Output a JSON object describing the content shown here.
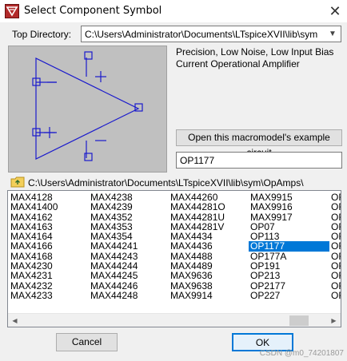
{
  "window": {
    "title": "Select Component Symbol",
    "close_glyph": "✕"
  },
  "top_directory": {
    "label": "Top Directory:",
    "value": "C:\\Users\\Administrator\\Documents\\LTspiceXVII\\lib\\sym"
  },
  "symbol": {
    "description": "Precision, Low Noise, Low Input Bias Current Operational Amplifier",
    "example_button": "Open this macromodel's example circuit",
    "name": "OP1177"
  },
  "current_path": "C:\\Users\\Administrator\\Documents\\LTspiceXVII\\lib\\sym\\OpAmps\\",
  "components": {
    "columns": [
      [
        "MAX4128",
        "MAX41400",
        "MAX4162",
        "MAX4163",
        "MAX4164",
        "MAX4166",
        "MAX4168",
        "MAX4230",
        "MAX4231",
        "MAX4232",
        "MAX4233"
      ],
      [
        "MAX4238",
        "MAX4239",
        "MAX4352",
        "MAX4353",
        "MAX4354",
        "MAX44241",
        "MAX44243",
        "MAX44244",
        "MAX44245",
        "MAX44246",
        "MAX44248"
      ],
      [
        "MAX44260",
        "MAX44281O",
        "MAX44281U",
        "MAX44281V",
        "MAX4434",
        "MAX4436",
        "MAX4488",
        "MAX4489",
        "MAX9636",
        "MAX9638",
        "MAX9914"
      ],
      [
        "MAX9915",
        "MAX9916",
        "MAX9917",
        "OP07",
        "OP113",
        "OP1177",
        "OP177A",
        "OP191",
        "OP213",
        "OP2177",
        "OP227"
      ],
      [
        "OF",
        "OF",
        "OF",
        "OF",
        "OF",
        "OF",
        "OF",
        "OF",
        "OF",
        "OF",
        "OF"
      ]
    ],
    "selected": "OP1177"
  },
  "buttons": {
    "cancel": "Cancel",
    "ok": "OK"
  },
  "watermark": "CSDN @m0_74201807",
  "colors": {
    "selection": "#0078d7",
    "symbol_stroke": "#1a1acc",
    "preview_bg": "#c0c0c0"
  }
}
